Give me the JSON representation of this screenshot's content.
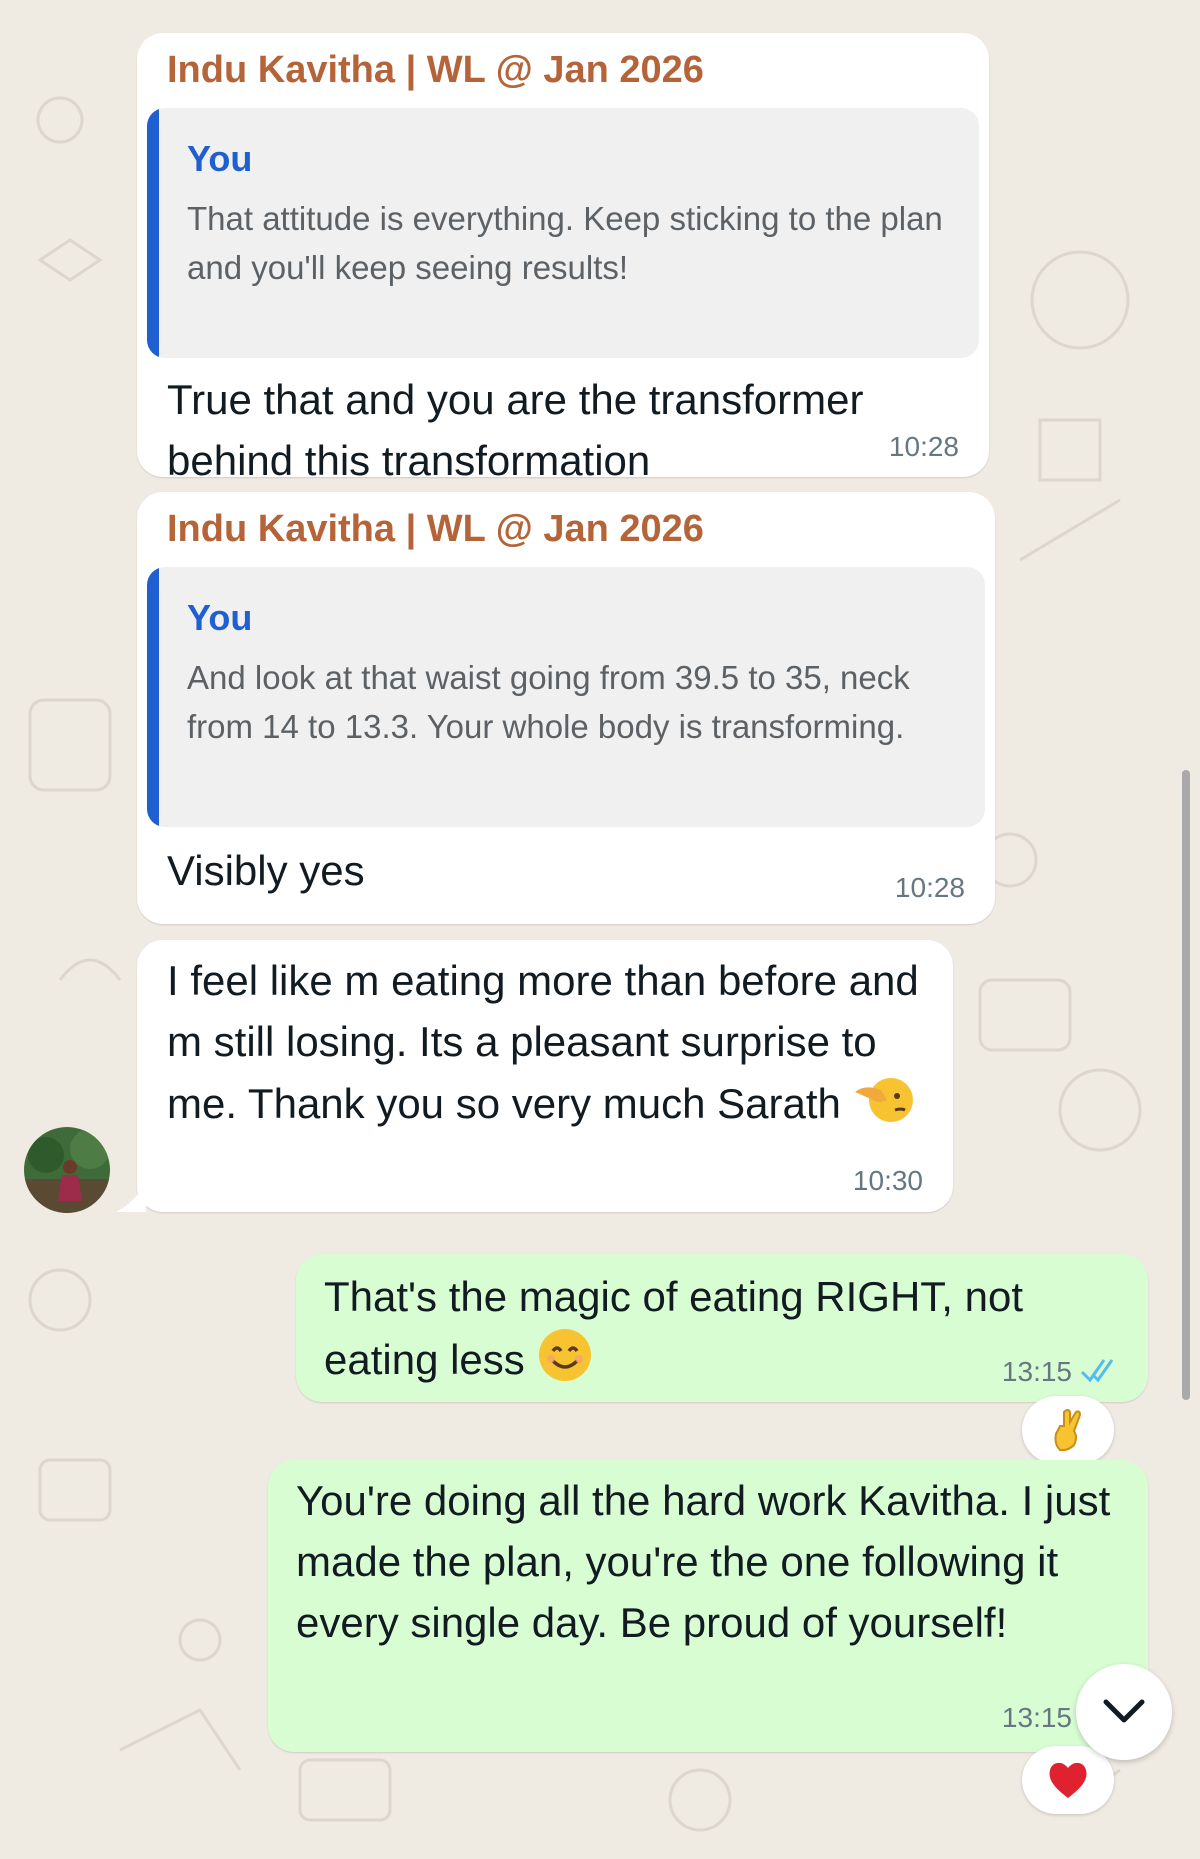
{
  "messages": [
    {
      "sender": "Indu Kavitha | WL @ Jan 2026",
      "quote_author": "You",
      "quote_text": "That attitude is everything. Keep sticking to the plan and you'll keep seeing results!",
      "text": "True that and you are the transformer behind this transformation",
      "time": "10:28"
    },
    {
      "sender": "Indu Kavitha | WL @ Jan 2026",
      "quote_author": "You",
      "quote_text": "And look at that waist going from 39.5 to 35, neck from 14 to 13.3. Your whole body is transforming.",
      "text": "Visibly yes",
      "time": "10:28"
    },
    {
      "text": "I feel like m eating more than before and m still losing. Its a pleasant surprise to me. Thank you so very much Sarath",
      "emoji": "saluting-face",
      "time": "10:30"
    },
    {
      "text": "That's the magic of eating RIGHT, not eating less",
      "emoji": "smiling-face",
      "time": "13:15",
      "status": "read",
      "reaction": "crossed-fingers"
    },
    {
      "text": "You're doing all the hard work Kavitha. I just made the plan, you're the one following it every single day. Be proud of yourself!",
      "time": "13:15",
      "reaction": "red-heart"
    }
  ],
  "colors": {
    "background": "#efeae2",
    "incoming_bubble": "#ffffff",
    "outgoing_bubble": "#d9fdd3",
    "sender_name": "#b5643a",
    "quote_accent": "#1f5fd0",
    "read_ticks": "#53bdeb"
  },
  "icons": {
    "scroll_down": "chevron-down-icon",
    "read_receipt": "double-check-icon"
  }
}
